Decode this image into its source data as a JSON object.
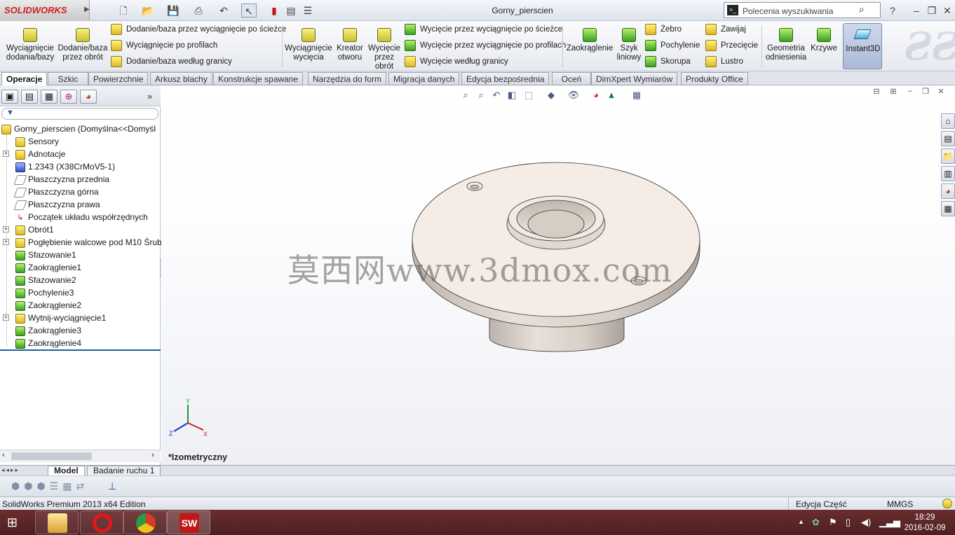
{
  "app": {
    "brand": "SOLIDWORKS",
    "doc_title": "Gorny_pierscien",
    "edition": "SolidWorks Premium 2013 x64 Edition"
  },
  "search": {
    "placeholder": "Polecenia wyszukiwania"
  },
  "commands": {
    "extrude_boss": "Wyciągnięcie dodania/bazy",
    "revolve_boss": "Dodanie/baza przez obrót",
    "sweep_boss": "Dodanie/baza przez wyciągnięcie po ścieżce",
    "loft_boss": "Wyciągnięcie po profilach",
    "boundary_boss": "Dodanie/baza według granicy",
    "extrude_cut": "Wyciągnięcie wycięcia",
    "hole_wizard": "Kreator otworu",
    "revolve_cut": "Wycięcie przez obrót",
    "sweep_cut": "Wycięcie przez wyciągnięcie po ścieżce",
    "loft_cut": "Wycięcie przez wyciągnięcie po profilach",
    "boundary_cut": "Wycięcie według granicy",
    "fillet": "Zaokrąglenie",
    "linear_pattern": "Szyk liniowy",
    "rib": "Żebro",
    "draft": "Pochylenie",
    "shell": "Skorupa",
    "wrap": "Zawijaj",
    "intersect": "Przecięcie",
    "mirror": "Lustro",
    "reference_geometry": "Geometria odniesienia",
    "curves": "Krzywe",
    "instant3d": "Instant3D"
  },
  "tabs": [
    "Operacje",
    "Szkic",
    "Powierzchnie",
    "Arkusz blachy",
    "Konstrukcje spawane",
    "Narzędzia do form",
    "Migracja danych",
    "Edycja bezpośrednia",
    "Oceń",
    "DimXpert Wymiarów",
    "Produkty Office"
  ],
  "tree": {
    "root": "Gorny_pierscien  (Domyślna<<Domyśl",
    "items": [
      "Sensory",
      "Adnotacje",
      "1.2343 (X38CrMoV5-1)",
      "Płaszczyzna przednia",
      "Płaszczyzna górna",
      "Płaszczyzna prawa",
      "Początek układu współrzędnych",
      "Obrót1",
      "Pogłębienie walcowe pod M10 Śrub",
      "Sfazowanie1",
      "Zaokrąglenie1",
      "Sfazowanie2",
      "Pochylenie3",
      "Zaokrąglenie2",
      "Wytnij-wyciągnięcie1",
      "Zaokrąglenie3",
      "Zaokrąglenie4"
    ]
  },
  "viewport": {
    "view_name": "*Izometryczny",
    "watermark": "莫西网www.3dmox.com",
    "axes": {
      "y": "Y",
      "x": "X",
      "z": "Z"
    }
  },
  "bottom_tabs": [
    "Model",
    "Badanie ruchu 1"
  ],
  "status": {
    "left": "SolidWorks Premium 2013 x64 Edition",
    "mode": "Edycja Część",
    "units": "MMGS"
  },
  "taskbar": {
    "time": "18:29",
    "date": "2016-02-09"
  },
  "colors": {
    "accent": "#1e5fa8",
    "model": "#f2ebe4",
    "taskbar": "#5a2426"
  }
}
